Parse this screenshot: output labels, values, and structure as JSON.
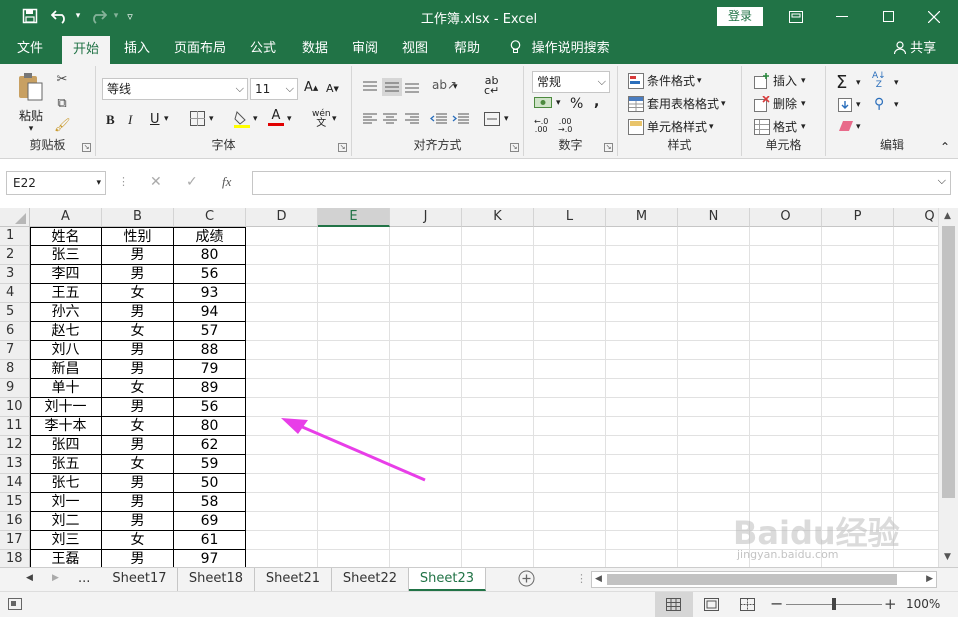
{
  "titlebar": {
    "title": "工作簿.xlsx  -  Excel",
    "login_label": "登录",
    "icons": [
      "save-icon",
      "undo-icon",
      "redo-icon",
      "customize-icon"
    ],
    "controls": [
      "ribbon-display-icon",
      "minimize-icon",
      "maximize-icon",
      "close-icon"
    ]
  },
  "menu": {
    "tabs": [
      "文件",
      "开始",
      "插入",
      "页面布局",
      "公式",
      "数据",
      "审阅",
      "视图",
      "帮助"
    ],
    "active": "开始",
    "search": "操作说明搜索",
    "share": "共享"
  },
  "ribbon": {
    "clipboard": {
      "paste": "粘贴",
      "label": "剪贴板"
    },
    "font": {
      "name": "等线",
      "size": "11",
      "label": "字体"
    },
    "alignment": {
      "label": "对齐方式"
    },
    "number": {
      "format": "常规",
      "label": "数字",
      "percent": "%"
    },
    "styles": {
      "conditional": "条件格式",
      "table": "套用表格格式",
      "cell": "单元格样式",
      "label": "样式"
    },
    "cells": {
      "insert": "插入",
      "delete": "删除",
      "format": "格式",
      "label": "单元格"
    },
    "editing": {
      "label": "编辑"
    }
  },
  "formula_bar": {
    "name_box": "E22",
    "fx": "fx"
  },
  "grid": {
    "columns": [
      "A",
      "B",
      "C",
      "D",
      "E",
      "J",
      "K",
      "L",
      "M",
      "N",
      "O",
      "P",
      "Q"
    ],
    "selected_column": "E",
    "rows": [
      "1",
      "2",
      "3",
      "4",
      "5",
      "6",
      "7",
      "8",
      "9",
      "10",
      "11",
      "12",
      "13",
      "14",
      "15",
      "16",
      "17",
      "18"
    ],
    "data": [
      [
        "姓名",
        "性别",
        "成绩"
      ],
      [
        "张三",
        "男",
        "80"
      ],
      [
        "李四",
        "男",
        "56"
      ],
      [
        "王五",
        "女",
        "93"
      ],
      [
        "孙六",
        "男",
        "94"
      ],
      [
        "赵七",
        "女",
        "57"
      ],
      [
        "刘八",
        "男",
        "88"
      ],
      [
        "新昌",
        "男",
        "79"
      ],
      [
        "单十",
        "女",
        "89"
      ],
      [
        "刘十一",
        "男",
        "56"
      ],
      [
        "李十本",
        "女",
        "80"
      ],
      [
        "张四",
        "男",
        "62"
      ],
      [
        "张五",
        "女",
        "59"
      ],
      [
        "张七",
        "男",
        "50"
      ],
      [
        "刘一",
        "男",
        "58"
      ],
      [
        "刘二",
        "男",
        "69"
      ],
      [
        "刘三",
        "女",
        "61"
      ],
      [
        "王磊",
        "男",
        "97"
      ]
    ]
  },
  "sheets": {
    "ellipsis": "...",
    "tabs": [
      "Sheet17",
      "Sheet18",
      "Sheet21",
      "Sheet22",
      "Sheet23"
    ],
    "active": "Sheet23"
  },
  "status": {
    "zoom": "100%"
  },
  "watermark": {
    "text": "Baidu经验",
    "url": "jingyan.baidu.com"
  },
  "annotation_color": "#e83ee8"
}
